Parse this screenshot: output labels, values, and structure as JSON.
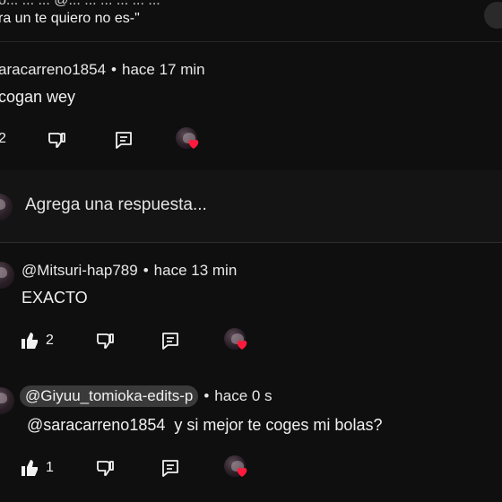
{
  "top_comment": {
    "partial_line_1": "o... ... ... @... ... ... ... ... ...",
    "partial_line_2": "ra un te quiero no es-\""
  },
  "reply_1": {
    "author": "aracarreno1854",
    "time": "hace 17 min",
    "text": "cogan wey",
    "likes": "2"
  },
  "reply_box": {
    "placeholder": "Agrega una respuesta..."
  },
  "reply_2": {
    "author": "@Mitsuri-hap789",
    "time": "hace 13 min",
    "text": "EXACTO",
    "likes": "2"
  },
  "reply_3": {
    "author": "@Giyuu_tomioka-edits-p",
    "time": "hace 0 s",
    "mention": "@saracarreno1854",
    "text": "y si mejor te coges mi bolas?",
    "likes": "1"
  },
  "separator": "•",
  "colors": {
    "background": "#0f0f0f",
    "reply_box_bg": "#0f0f0f",
    "heart": "#ff1a3c",
    "chip_bg": "#3a3a3a"
  },
  "icons": [
    "thumbs-up-icon",
    "thumbs-down-icon",
    "reply-icon",
    "creator-heart-icon"
  ]
}
